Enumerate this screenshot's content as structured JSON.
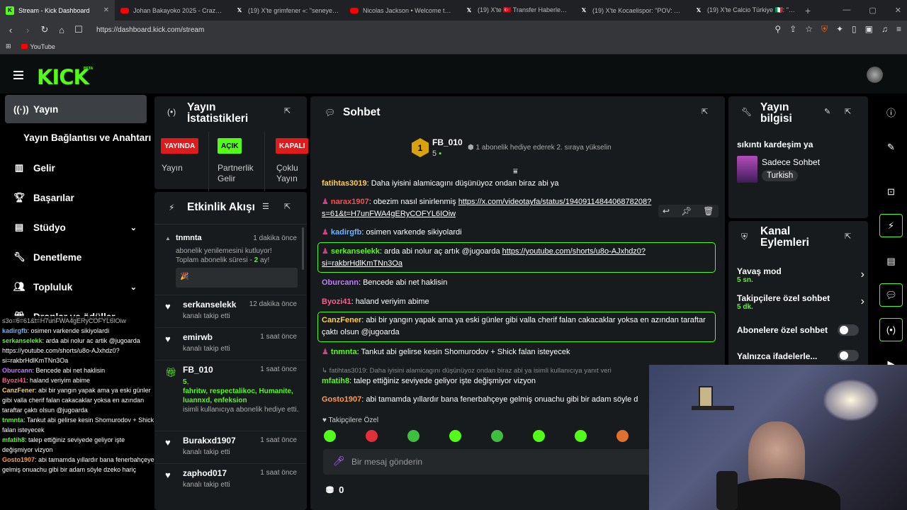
{
  "browser": {
    "tabs": [
      {
        "label": "Stream - Kick Dashboard",
        "icon": "kick-icon",
        "color": "#53fc18",
        "active": true
      },
      {
        "label": "Johan Bakayoko 2025 - Crazy Skills, ",
        "icon": "youtube-icon",
        "color": "#ff0000"
      },
      {
        "label": "(19) X'te grimfener «: \"seneye onun",
        "icon": "x-icon",
        "color": "#ffffff"
      },
      {
        "label": "Nicolas Jackson • Welcome to Baye",
        "icon": "youtube-icon",
        "color": "#ff0000"
      },
      {
        "label": "(19) X'te 🇹🇷 Transfer Haberleri ⚜️",
        "icon": "x-icon",
        "color": "#ffffff"
      },
      {
        "label": "(19) X'te Kocaelispor: \"POV: You are",
        "icon": "x-icon",
        "color": "#ffffff"
      },
      {
        "label": "(19) X'te Calcio Türkiye 🇮🇹: \"😮 Bu",
        "icon": "x-icon",
        "color": "#ffffff"
      }
    ],
    "new_tab": "+",
    "url": "https://dashboard.kick.com/stream",
    "bookmark": "YouTube"
  },
  "kick": {
    "logo": "KICK",
    "beta": "BETA",
    "accent": "#53fc18"
  },
  "sidebar": {
    "items": [
      {
        "label": "Yayın",
        "icon": "broadcast-icon"
      },
      {
        "label": "Yayın Bağlantısı ve Anahtarı"
      },
      {
        "label": "Gelir",
        "icon": "chart-icon"
      },
      {
        "label": "Başarılar",
        "icon": "trophy-icon"
      },
      {
        "label": "Stüdyo",
        "icon": "studio-icon"
      },
      {
        "label": "Denetleme",
        "icon": "wrench-icon"
      },
      {
        "label": "Topluluk",
        "icon": "people-icon"
      },
      {
        "label": "Droplar ve ödüller",
        "icon": "gift-icon"
      }
    ]
  },
  "overlay_chat": [
    {
      "name": "",
      "text": "s3o=6=61&t=H7unFWA4gERyCOFYL6IOiw",
      "color": "#bbbbbb"
    },
    {
      "name": "kadirgfb",
      "text": ": osimen varkende sikiyolardi",
      "color": "#6fb3ff"
    },
    {
      "name": "serkanselekk",
      "text": ": arda abi nolur ac artik @jugoarda https://youtube.com/shorts/u8o-AJxhdz0?si=rakbrHdlKmTNn3Oa",
      "color": "#53fc18"
    },
    {
      "name": "Oburcann",
      "text": ": Bencede abi net haklisin",
      "color": "#c07cff"
    },
    {
      "name": "Byozi41",
      "text": ": haland veriyim abime",
      "color": "#ff5d8f"
    },
    {
      "name": "CanzFener",
      "text": ": abi bir yangın yapak ama ya eski günler gibi valla cherif falan cakacaklar yoksa en azından taraftar çaktı olsun @jugoarda",
      "color": "#ffcf4d"
    },
    {
      "name": "tnmnta",
      "text": ": Tankut abi gelirse kesin Shomurodov + Shick falan isteyecek",
      "color": "#53fc18"
    },
    {
      "name": "mfatih8",
      "text": ": talep ettiğiniz seviyede geliyor işte değişmiyor vizyon",
      "color": "#53fc18"
    },
    {
      "name": "Gosto1907",
      "text": ": abi tamamda yıllardır bana fenerbahçeye gelmiş onuachu gibi bir adam söyle dzeko hariç",
      "color": "#ff9d4d"
    }
  ],
  "stats": {
    "title_1": "Yayın",
    "title_2": "İstatistikleri",
    "badges": [
      {
        "label": "YAYINDA",
        "bg": "#e01b1b",
        "fg": "#ffffff",
        "desc1": "Yayın",
        "desc2": ""
      },
      {
        "label": "AÇIK",
        "bg": "#53fc18",
        "fg": "#000000",
        "desc1": "Partnerlik",
        "desc2": "Gelir"
      },
      {
        "label": "KAPALI",
        "bg": "#e01b1b",
        "fg": "#ffffff",
        "desc1": "Çoklu",
        "desc2": "Yayın"
      }
    ]
  },
  "activity": {
    "title": "Etkinlik Akışı",
    "events": [
      {
        "name": "tnmnta",
        "time": "1 dakika önce",
        "line1": "abonelik yenilemesini kutluyor!",
        "line2a": "Toplam abonelik süresi - ",
        "line2b": "2",
        "line2c": " ay!",
        "icon": "resub-icon"
      },
      {
        "name": "serkanselekk",
        "time": "12 dakika önce",
        "sub": "kanalı takip etti",
        "icon": "heart-icon"
      },
      {
        "name": "emirwb",
        "time": "1 saat önce",
        "sub": "kanalı takip etti",
        "icon": "heart-icon"
      },
      {
        "name": "FB_010",
        "time": "1 saat önce",
        "count": "5",
        "gifted_to": "fahritw, respectalikoc, Humanite, luannxd, enfeksion",
        "sub": "isimli kullanıcıya abonelik hediye etti.",
        "icon": "gift-icon"
      },
      {
        "name": "Burakxd1907",
        "time": "1 saat önce",
        "sub": "kanalı takip etti",
        "icon": "heart-icon"
      },
      {
        "name": "zaphod017",
        "time": "1 saat önce",
        "sub": "kanalı takip etti",
        "icon": "heart-icon"
      }
    ]
  },
  "chat": {
    "title": "Sohbet",
    "leader": {
      "rank": "1",
      "name": "FB_010",
      "count": "5",
      "note": "1 abonelik hediye ederek 2. sıraya yükselin"
    },
    "messages": [
      {
        "name": "fatihtas3019",
        "color": "#ffcf4d",
        "text": ": Daha iyisini alamicagını düşünüyoz ondan biraz abi ya"
      },
      {
        "name": "narax1907",
        "color": "#ff4d4d",
        "text": ": obezim nasıl sinirlenmiş ",
        "link": "https://x.com/videotayfa/status/1940911484406878208?s=61&t=H7unFWA4gERyCOFYL6IOiw"
      },
      {
        "name": "kadirgfb",
        "color": "#6fb3ff",
        "text": ": osimen varkende sikiyolardi"
      },
      {
        "name": "serkanselekk",
        "color": "#53fc18",
        "text": ": arda abi nolur aç artık @jugoarda ",
        "link": "https://youtube.com/shorts/u8o-AJxhdz0?si=rakbrHdlKmTNn3Oa"
      },
      {
        "name": "Oburcann",
        "color": "#c07cff",
        "text": ": Bencede abi net haklisin"
      },
      {
        "name": "Byozi41",
        "color": "#ff5d8f",
        "text": ": haland veriyim abime"
      },
      {
        "name": "CanzFener",
        "color": "#ffcf4d",
        "text": ": abi bir yangın yapak ama ya eski günler gibi valla cherif falan cakacaklar yoksa en azından taraftar çaktı olsun @jugoarda"
      },
      {
        "name": "tnmnta",
        "color": "#53fc18",
        "text": ": Tankut abi gelirse kesin Shomurodov + Shick falan isteyecek"
      },
      {
        "name": "",
        "color": "#888888",
        "text": "↳ fatihtas3019: Daha iyisini alamicagını düşünüyoz ondan biraz abi ya isimli kullanıcıya yanıt veri"
      },
      {
        "name": "mfatih8",
        "color": "#53fc18",
        "text": ": talep ettiğiniz seviyede geliyor işte değişmiyor vizyon"
      },
      {
        "name": "Gosto1907",
        "color": "#ff9d4d",
        "text": ": abi tamamda yıllardır bana fenerbahçeye gelmiş onuachu gibi bir adam söyle d"
      }
    ],
    "followers_only": "Takipçilere Özel",
    "placeholder": "Bir mesaj gönderin",
    "points": "0"
  },
  "stream_info": {
    "title_1": "Yayın",
    "title_2": "bilgisi",
    "stream_title": "sıkıntı kardeşim ya",
    "category": "Sadece Sohbet",
    "language": "Turkish"
  },
  "channel_actions": {
    "title_1": "Kanal",
    "title_2": "Eylemleri",
    "items": [
      {
        "label": "Yavaş mod",
        "value": "5 sn.",
        "kind": "chevron"
      },
      {
        "label": "Takipçilere özel sohbet",
        "value": "5 dk.",
        "kind": "chevron"
      },
      {
        "label": "Abonelere özel sohbet",
        "value": "",
        "kind": "toggle"
      },
      {
        "label": "Yalnızca ifadelerle...",
        "value": "",
        "kind": "toggle"
      }
    ]
  }
}
